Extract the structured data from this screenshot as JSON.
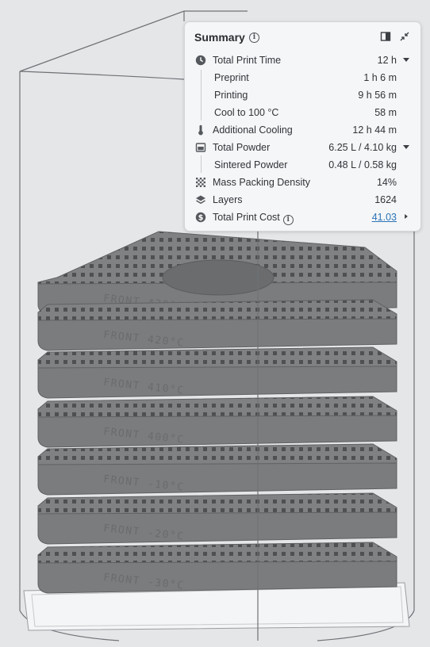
{
  "colors": {
    "background": "#e4e6e8",
    "part_fill": "#7b7c7e",
    "part_dark": "#606163",
    "link": "#2b74b8"
  },
  "scene": {
    "part_labels": [
      "FRONT 430°C",
      "FRONT 420°C",
      "FRONT 410°C",
      "FRONT 400°C",
      "FRONT -10°C",
      "FRONT -20°C",
      "FRONT -30°C"
    ]
  },
  "summary": {
    "title": "Summary",
    "rows": {
      "total_print_time": {
        "icon": "clock-icon",
        "label": "Total Print Time",
        "value": "12 h"
      },
      "preprint": {
        "label": "Preprint",
        "value": "1 h 6 m"
      },
      "printing": {
        "label": "Printing",
        "value": "9 h 56 m"
      },
      "cool": {
        "label": "Cool to 100 °C",
        "value": "58 m"
      },
      "additional_cooling": {
        "icon": "thermometer-icon",
        "label": "Additional Cooling",
        "value": "12 h 44 m"
      },
      "total_powder": {
        "icon": "powder-icon",
        "label": "Total Powder",
        "value": "6.25 L / 4.10 kg"
      },
      "sintered_powder": {
        "label": "Sintered Powder",
        "value": "0.48 L / 0.58 kg"
      },
      "mass_packing_density": {
        "icon": "density-icon",
        "label": "Mass Packing Density",
        "value": "14%"
      },
      "layers": {
        "icon": "layers-icon",
        "label": "Layers",
        "value": "1624"
      },
      "total_print_cost": {
        "icon": "cost-icon",
        "label": "Total Print Cost",
        "value": "41.03"
      }
    }
  }
}
